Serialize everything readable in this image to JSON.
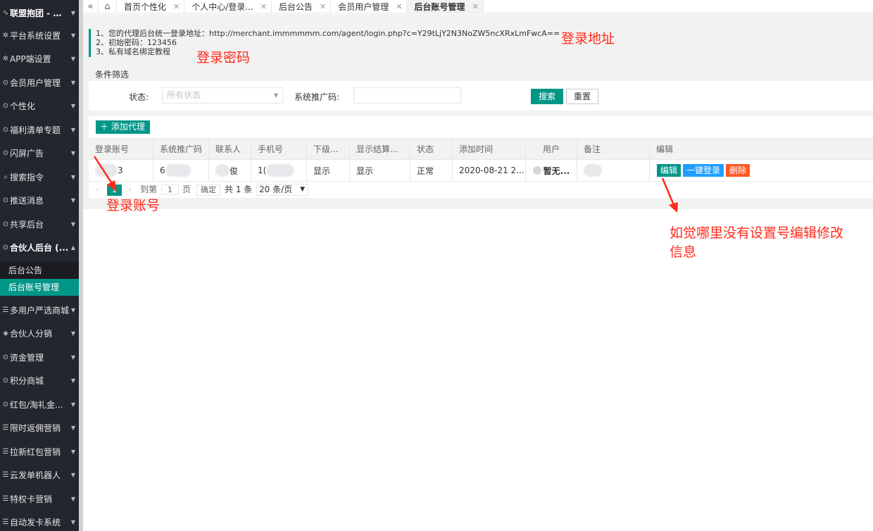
{
  "sidebar": {
    "header": "联盟抱团 - 渠...",
    "items": [
      {
        "label": "平台系统设置",
        "icon": "gear-icon"
      },
      {
        "label": "APP端设置",
        "icon": "gear-icon"
      },
      {
        "label": "会员用户管理",
        "icon": "shield-icon"
      },
      {
        "label": "个性化",
        "icon": "shield-icon"
      },
      {
        "label": "福利清单专题",
        "icon": "shield-icon"
      },
      {
        "label": "闪屏广告",
        "icon": "shield-icon"
      },
      {
        "label": "搜索指令",
        "icon": "search-icon"
      },
      {
        "label": "推送消息",
        "icon": "shield-icon"
      },
      {
        "label": "共享后台",
        "icon": "shield-icon"
      },
      {
        "label": "合伙人后台 (...",
        "icon": "shield-icon"
      }
    ],
    "sub_items": [
      "后台公告",
      "后台账号管理"
    ],
    "items_after": [
      {
        "label": "多用户严选商城",
        "icon": "menu-icon"
      },
      {
        "label": "合伙人分销",
        "icon": "layers-icon"
      },
      {
        "label": "资金管理",
        "icon": "shield-icon"
      },
      {
        "label": "积分商城",
        "icon": "shield-icon"
      },
      {
        "label": "红包/淘礼金...",
        "icon": "shield-icon"
      },
      {
        "label": "限时返佣营销",
        "icon": "menu-icon"
      },
      {
        "label": "拉新红包营销",
        "icon": "menu-icon"
      },
      {
        "label": "云发单机器人",
        "icon": "menu-icon"
      },
      {
        "label": "特权卡营销",
        "icon": "menu-icon"
      },
      {
        "label": "自动发卡系统",
        "icon": "menu-icon"
      }
    ]
  },
  "tabs": [
    "首页个性化",
    "个人中心/登录...",
    "后台公告",
    "会员用户管理",
    "后台账号管理"
  ],
  "notice": {
    "line1": "1、您的代理后台统一登录地址：http://merchant.immmmmm.com/agent/login.php?c=Y29tLjY2N3NoZW5ncXRxLmFwcA==",
    "line2": "2、初始密码：123456",
    "line3": "3、私有域名绑定教程"
  },
  "annotations": {
    "login_url": "登录地址",
    "login_password": "登录密码",
    "login_account": "登录账号",
    "edit_hint_1": "如觉哪里没有设置号编辑修改",
    "edit_hint_2": "信息"
  },
  "filter": {
    "title": "条件筛选",
    "status_label": "状态:",
    "status_placeholder": "所有状态",
    "promo_label": "系统推广码:",
    "search": "搜索",
    "reset": "重置"
  },
  "table": {
    "add_button": "添加代理",
    "headers": [
      "登录账号",
      "系统推广码",
      "联系人",
      "手机号",
      "下级...",
      "显示结算...",
      "状态",
      "添加时间",
      "用户",
      "备注",
      "编辑"
    ],
    "row": {
      "account": "3",
      "promo": "6",
      "contact": "俊",
      "phone": "1(",
      "sub": "显示",
      "settle": "显示",
      "status": "正常",
      "added": "2020-08-21 2...",
      "user": "暂无...",
      "note": "",
      "ops": [
        "编辑",
        "一键登录",
        "删除"
      ]
    }
  },
  "pager": {
    "current": "1",
    "goto": "到第",
    "page_input": "1",
    "page_unit": "页",
    "confirm": "确定",
    "total": "共 1 条",
    "size": "20 条/页"
  },
  "colors": {
    "accent": "#009688",
    "sidebar_bg": "#23262e",
    "annotation": "#ff2a1a",
    "login_btn": "#1e9fff",
    "delete_btn": "#ff5722"
  }
}
